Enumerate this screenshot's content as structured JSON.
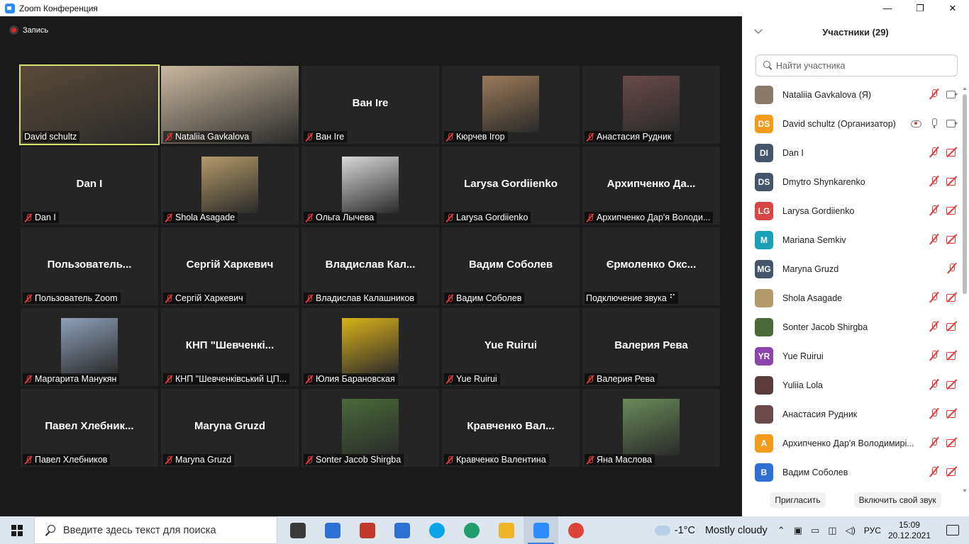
{
  "window": {
    "title": "Zoom Конференция",
    "min": "—",
    "restore": "❐",
    "close": "✕"
  },
  "recording": {
    "label": "Запись"
  },
  "tiles": [
    {
      "big": "",
      "label": "David schultz",
      "muted": false,
      "photo": "full",
      "color": "#5a4a3a",
      "active": true
    },
    {
      "big": "",
      "label": "Nataliia Gavkalova",
      "muted": true,
      "photo": "full",
      "color": "#c9b8a0",
      "active": false
    },
    {
      "big": "Ван Ire",
      "label": "Ван Ire",
      "muted": true,
      "photo": "",
      "color": "",
      "active": false
    },
    {
      "big": "",
      "label": "Кюрчев Ігор",
      "muted": true,
      "photo": "small",
      "color": "#9a7a5a",
      "active": false
    },
    {
      "big": "",
      "label": "Анастасия Рудник",
      "muted": true,
      "photo": "small",
      "color": "#6a4a4a",
      "active": false
    },
    {
      "big": "Dan I",
      "label": "Dan I",
      "muted": true,
      "photo": "",
      "color": "",
      "active": false
    },
    {
      "big": "",
      "label": "Shola Asagade",
      "muted": true,
      "photo": "small",
      "color": "#b29a6a",
      "active": false
    },
    {
      "big": "",
      "label": "Ольга Лычева",
      "muted": true,
      "photo": "small",
      "color": "#d8d8d8",
      "active": false
    },
    {
      "big": "Larysa Gordiienko",
      "label": "Larysa Gordiienko",
      "muted": true,
      "photo": "",
      "color": "",
      "active": false
    },
    {
      "big": "Архипченко  Да...",
      "label": "Архипченко Дар'я Володи...",
      "muted": true,
      "photo": "",
      "color": "",
      "active": false
    },
    {
      "big": "Пользователь...",
      "label": "Пользователь Zoom",
      "muted": true,
      "photo": "",
      "color": "",
      "active": false
    },
    {
      "big": "Сергій Харкевич",
      "label": "Сергій Харкевич",
      "muted": true,
      "photo": "",
      "color": "",
      "active": false
    },
    {
      "big": "Владислав  Кал...",
      "label": "Владислав Калашников",
      "muted": true,
      "photo": "",
      "color": "",
      "active": false
    },
    {
      "big": "Вадим Соболев",
      "label": "Вадим Соболев",
      "muted": true,
      "photo": "",
      "color": "",
      "active": false
    },
    {
      "big": "Єрмоленко  Окс...",
      "label": "Подключение звука ⠋",
      "muted": false,
      "photo": "",
      "color": "",
      "active": false
    },
    {
      "big": "",
      "label": "Маргарита Манукян",
      "muted": true,
      "photo": "small",
      "color": "#8fa0b8",
      "active": false
    },
    {
      "big": "КНП  \"Шевченкі...",
      "label": "КНП \"Шевченківський ЦП...",
      "muted": true,
      "photo": "",
      "color": "",
      "active": false
    },
    {
      "big": "",
      "label": "Юлия Барановская",
      "muted": true,
      "photo": "small",
      "color": "#d9b21a",
      "active": false
    },
    {
      "big": "Yue Ruirui",
      "label": "Yue Ruirui",
      "muted": true,
      "photo": "",
      "color": "",
      "active": false
    },
    {
      "big": "Валерия Рева",
      "label": "Валерия Рева",
      "muted": true,
      "photo": "",
      "color": "",
      "active": false
    },
    {
      "big": "Павел  Хлебник...",
      "label": "Павел Хлебников",
      "muted": true,
      "photo": "",
      "color": "",
      "active": false
    },
    {
      "big": "Maryna Gruzd",
      "label": "Maryna Gruzd",
      "muted": true,
      "photo": "",
      "color": "",
      "active": false
    },
    {
      "big": "",
      "label": "Sonter Jacob Shirgba",
      "muted": true,
      "photo": "small",
      "color": "#4a6a3a",
      "active": false
    },
    {
      "big": "Кравченко  Вал...",
      "label": "Кравченко Валентина",
      "muted": true,
      "photo": "",
      "color": "",
      "active": false
    },
    {
      "big": "",
      "label": "Яна Маслова",
      "muted": true,
      "photo": "small",
      "color": "#6a8a5a",
      "active": false
    }
  ],
  "panel": {
    "title": "Участники (29)",
    "search_placeholder": "Найти участника",
    "participants": [
      {
        "initials": "",
        "avatar_color": "#8a7a6a",
        "name": "Nataliia Gavkalova (Я)",
        "icons": [
          "mic-off",
          "cam-on"
        ]
      },
      {
        "initials": "DS",
        "avatar_color": "#f29b1d",
        "name": "David schultz (Организатор)",
        "icons": [
          "share",
          "mic-on",
          "cam-on"
        ]
      },
      {
        "initials": "DI",
        "avatar_color": "#44546a",
        "name": "Dan I",
        "icons": [
          "mic-off",
          "cam-off"
        ]
      },
      {
        "initials": "DS",
        "avatar_color": "#44546a",
        "name": "Dmytro Shynkarenko",
        "icons": [
          "mic-off",
          "cam-off"
        ]
      },
      {
        "initials": "LG",
        "avatar_color": "#d64541",
        "name": "Larysa Gordiienko",
        "icons": [
          "mic-off",
          "cam-off"
        ]
      },
      {
        "initials": "M",
        "avatar_color": "#1aa0b8",
        "name": "Mariana Semkiv",
        "icons": [
          "mic-off",
          "cam-off"
        ]
      },
      {
        "initials": "MG",
        "avatar_color": "#44546a",
        "name": "Maryna Gruzd",
        "icons": [
          "mic-off"
        ]
      },
      {
        "initials": "",
        "avatar_color": "#b29a6a",
        "name": "Shola Asagade",
        "icons": [
          "mic-off",
          "cam-off"
        ]
      },
      {
        "initials": "",
        "avatar_color": "#4a6a3a",
        "name": "Sonter Jacob Shirgba",
        "icons": [
          "mic-off",
          "cam-off"
        ]
      },
      {
        "initials": "YR",
        "avatar_color": "#8e44ad",
        "name": "Yue Ruirui",
        "icons": [
          "mic-off",
          "cam-off"
        ]
      },
      {
        "initials": "",
        "avatar_color": "#5a3a3a",
        "name": "Yuliia Lola",
        "icons": [
          "mic-off",
          "cam-off"
        ]
      },
      {
        "initials": "",
        "avatar_color": "#6a4a4a",
        "name": "Анастасия Рудник",
        "icons": [
          "mic-off",
          "cam-off"
        ]
      },
      {
        "initials": "A",
        "avatar_color": "#f29b1d",
        "name": "Архипченко Дар'я Володимирі...",
        "icons": [
          "mic-off",
          "cam-off"
        ]
      },
      {
        "initials": "B",
        "avatar_color": "#2d6fd2",
        "name": "Вадим Соболев",
        "icons": [
          "mic-off",
          "cam-off"
        ]
      }
    ],
    "invite_label": "Пригласить",
    "unmute_label": "Включить свой звук"
  },
  "taskbar": {
    "search_text": "Введите здесь текст для поиска",
    "apps": [
      {
        "name": "task-view",
        "color": "#3a3a3a",
        "active": false
      },
      {
        "name": "store",
        "color": "#2d6fd2",
        "active": false
      },
      {
        "name": "gift",
        "color": "#c0392b",
        "active": false
      },
      {
        "name": "mail",
        "color": "#2d6fd2",
        "active": false
      },
      {
        "name": "skype",
        "color": "#0aa5e8",
        "active": false
      },
      {
        "name": "edge",
        "color": "#1f9d6a",
        "active": false
      },
      {
        "name": "explorer",
        "color": "#f0b429",
        "active": false
      },
      {
        "name": "zoom",
        "color": "#2d8cff",
        "active": true
      },
      {
        "name": "chrome",
        "color": "#db4437",
        "active": false
      }
    ],
    "temperature": "-1°C",
    "weather": "Mostly cloudy",
    "language": "РУС",
    "time": "15:09",
    "date": "20.12.2021"
  }
}
